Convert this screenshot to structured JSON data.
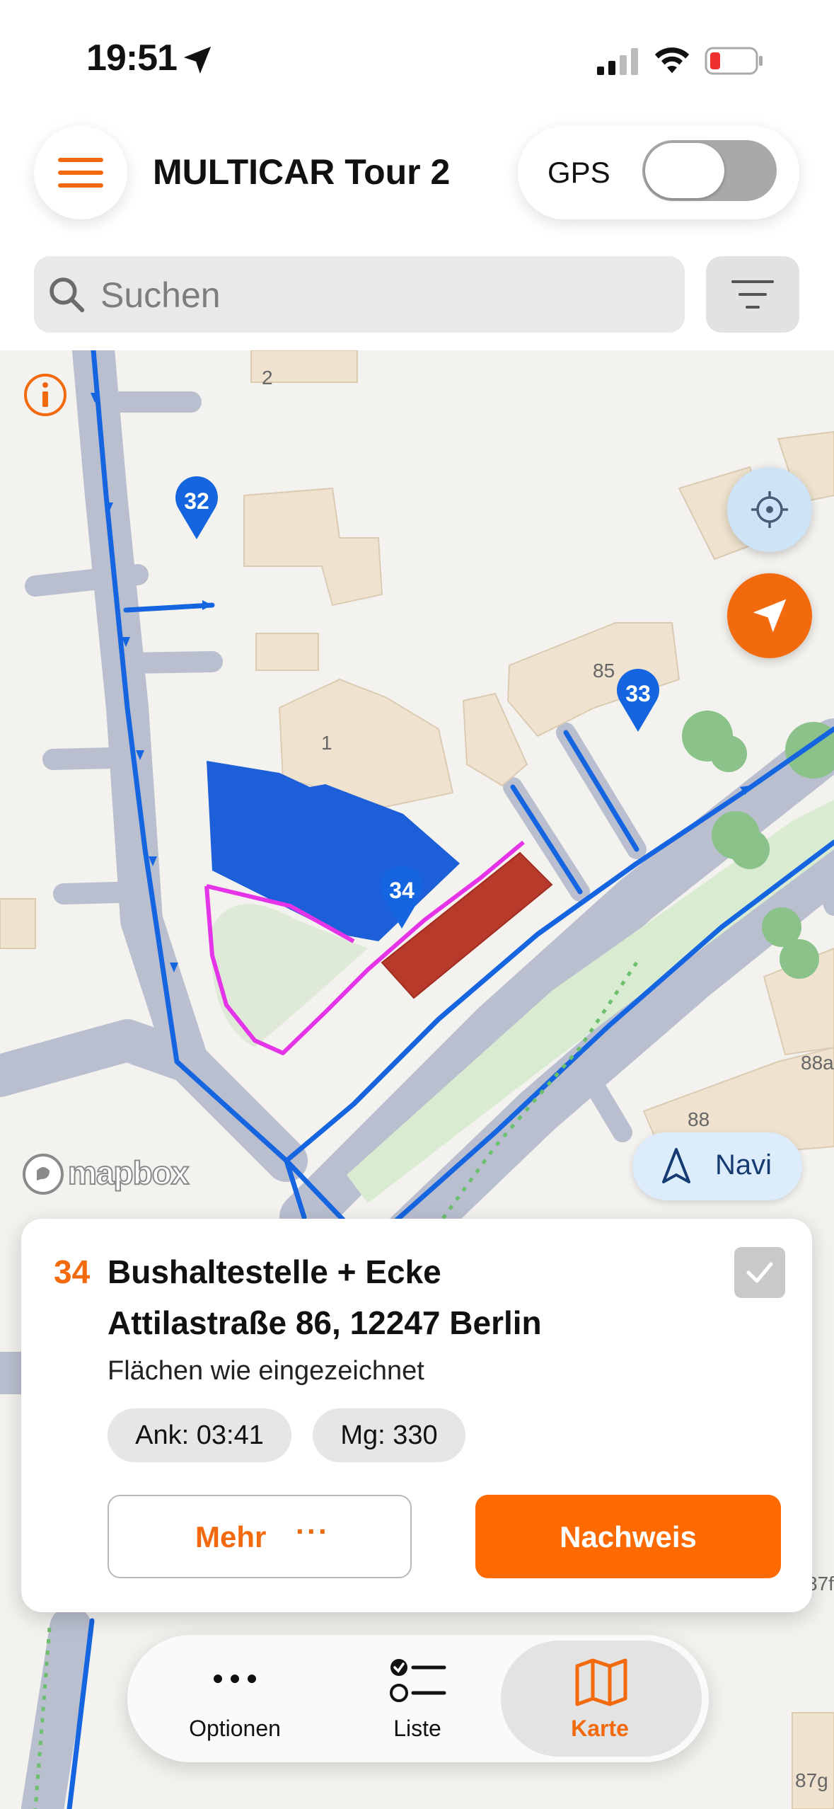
{
  "status_bar": {
    "time": "19:51"
  },
  "header": {
    "title": "MULTICAR Tour 2",
    "gps_label": "GPS",
    "gps_enabled": false,
    "search_placeholder": "Suchen"
  },
  "map": {
    "house_numbers": [
      "2",
      "1",
      "85",
      "88",
      "88a",
      "87g",
      "87f"
    ],
    "markers": [
      "32",
      "33",
      "34"
    ],
    "attribution": "mapbox",
    "navi_label": "Navi"
  },
  "card": {
    "number": "34",
    "title": "Bushaltestelle + Ecke",
    "address": "Attilastraße 86, 12247 Berlin",
    "description": "Flächen wie eingezeichnet",
    "chip_arrival": "Ank: 03:41",
    "chip_quantity": "Mg: 330",
    "more_label": "Mehr",
    "more_dots": "···",
    "proof_label": "Nachweis",
    "done": true
  },
  "tabbar": {
    "items": [
      {
        "label": "Optionen"
      },
      {
        "label": "Liste"
      },
      {
        "label": "Karte"
      }
    ],
    "active": "Karte"
  },
  "colors": {
    "accent": "#f26a0d",
    "route": "#1565e0",
    "area_blue": "#1c5fd8",
    "area_red": "#b83a2a",
    "path_magenta": "#e533e8"
  }
}
